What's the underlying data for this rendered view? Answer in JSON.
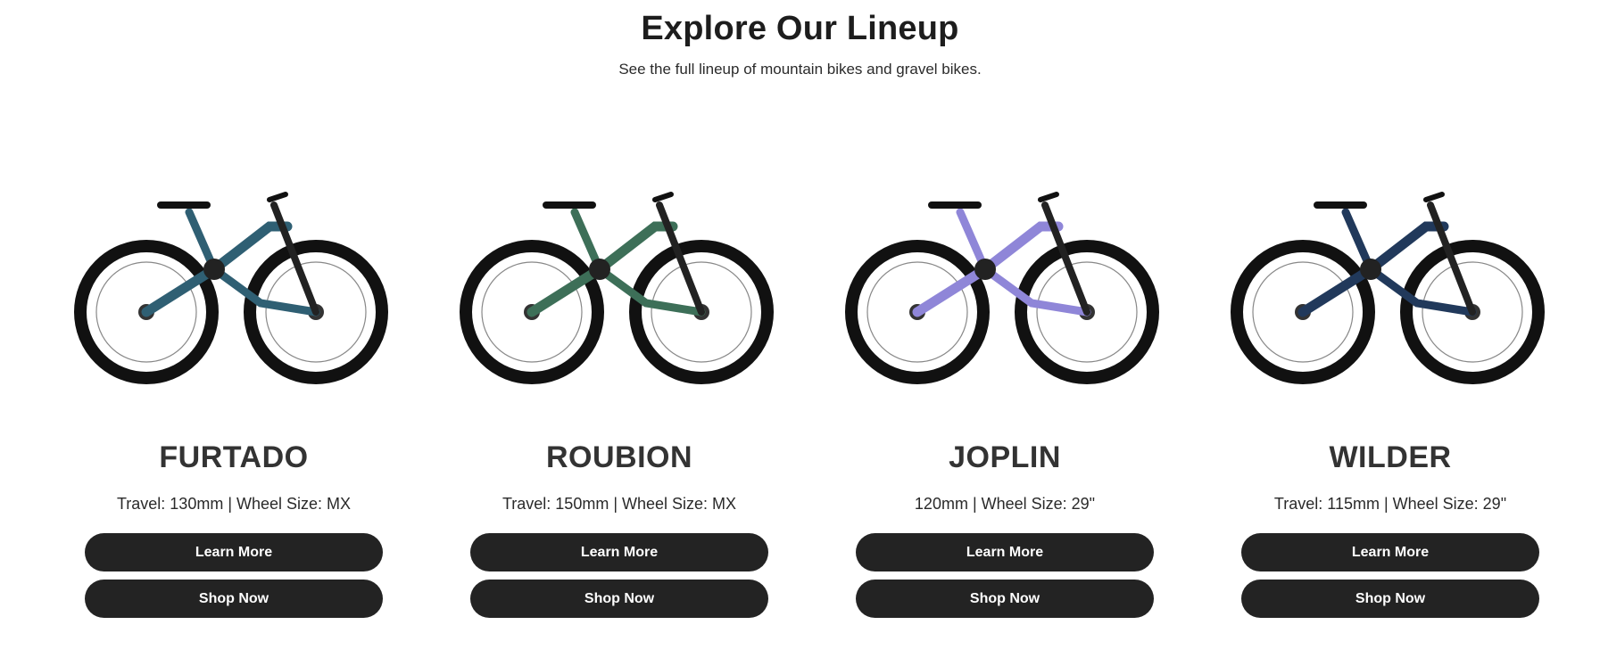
{
  "header": {
    "title": "Explore Our Lineup",
    "subtitle": "See the full lineup of mountain bikes and gravel bikes."
  },
  "bikes": [
    {
      "name": "FURTADO",
      "specs": "Travel: 130mm | Wheel Size: MX",
      "learn_label": "Learn More",
      "shop_label": "Shop Now",
      "frame_color": "#2f5f73",
      "image_alt": "FURTADO bike"
    },
    {
      "name": "ROUBION",
      "specs": "Travel: 150mm | Wheel Size: MX",
      "learn_label": "Learn More",
      "shop_label": "Shop Now",
      "frame_color": "#3d6f58",
      "image_alt": "ROUBION bike"
    },
    {
      "name": "JOPLIN",
      "specs": "120mm | Wheel Size: 29\"",
      "learn_label": "Learn More",
      "shop_label": "Shop Now",
      "frame_color": "#8f86d8",
      "image_alt": "JOPLIN bike"
    },
    {
      "name": "WILDER",
      "specs": "Travel: 115mm | Wheel Size: 29\"",
      "learn_label": "Learn More",
      "shop_label": "Shop Now",
      "frame_color": "#21395b",
      "image_alt": "WILDER bike"
    }
  ],
  "colors": {
    "button_bg": "#232323",
    "button_text": "#ffffff",
    "text": "#1f1f1f"
  }
}
